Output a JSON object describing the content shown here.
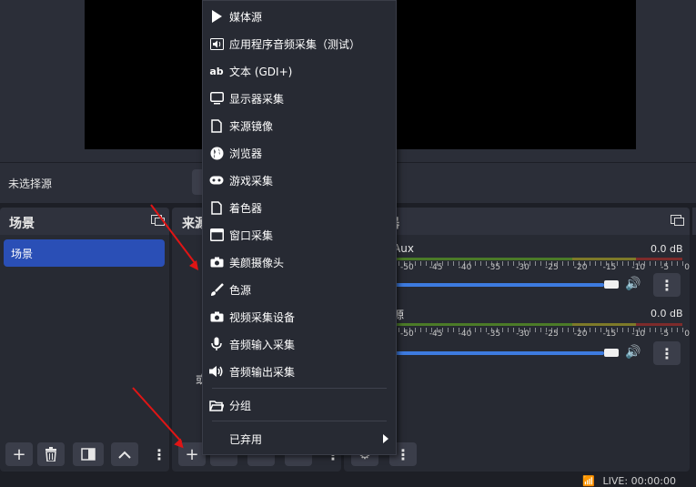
{
  "preview": {},
  "source_bar": {
    "no_source_label": "未选择源"
  },
  "scenes_dock": {
    "title": "场景",
    "items": [
      {
        "label": "场景"
      }
    ]
  },
  "sources_dock": {
    "title_partial": "来源",
    "hidden_text_1": "",
    "hidden_text_2": "或"
  },
  "mixer_dock": {
    "title_partial": "器",
    "channels": [
      {
        "name": "Aux",
        "db": "0.0 dB"
      },
      {
        "name": "源",
        "db": "0.0 dB"
      }
    ],
    "scale": [
      "-50",
      "-45",
      "-40",
      "-35",
      "-30",
      "-25",
      "-20",
      "-15",
      "-10",
      "-5",
      "0"
    ]
  },
  "context_menu": {
    "items": [
      {
        "icon": "play-icon",
        "label": "媒体源"
      },
      {
        "icon": "speaker-icon",
        "label": "应用程序音频采集（测试）"
      },
      {
        "icon": "text-ab-icon",
        "label": "文本 (GDI+)"
      },
      {
        "icon": "monitor-icon",
        "label": "显示器采集"
      },
      {
        "icon": "file-icon",
        "label": "来源镜像"
      },
      {
        "icon": "globe-icon",
        "label": "浏览器"
      },
      {
        "icon": "gamepad-icon",
        "label": "游戏采集"
      },
      {
        "icon": "file-icon",
        "label": "着色器"
      },
      {
        "icon": "window-icon",
        "label": "窗口采集"
      },
      {
        "icon": "camera-icon",
        "label": "美颜摄像头"
      },
      {
        "icon": "brush-icon",
        "label": "色源"
      },
      {
        "icon": "camera-icon",
        "label": "视频采集设备"
      },
      {
        "icon": "microphone-icon",
        "label": "音频输入采集"
      },
      {
        "icon": "speaker-icon",
        "label": "音频输出采集"
      }
    ],
    "group_label": "分组",
    "deprecated_label": "已弃用"
  },
  "status_bar": {
    "live": "LIVE: 00:00:00"
  },
  "colors": {
    "accent": "#2a4fb6",
    "annotation_arrow": "#e01515",
    "slider": "#3d7be0"
  }
}
